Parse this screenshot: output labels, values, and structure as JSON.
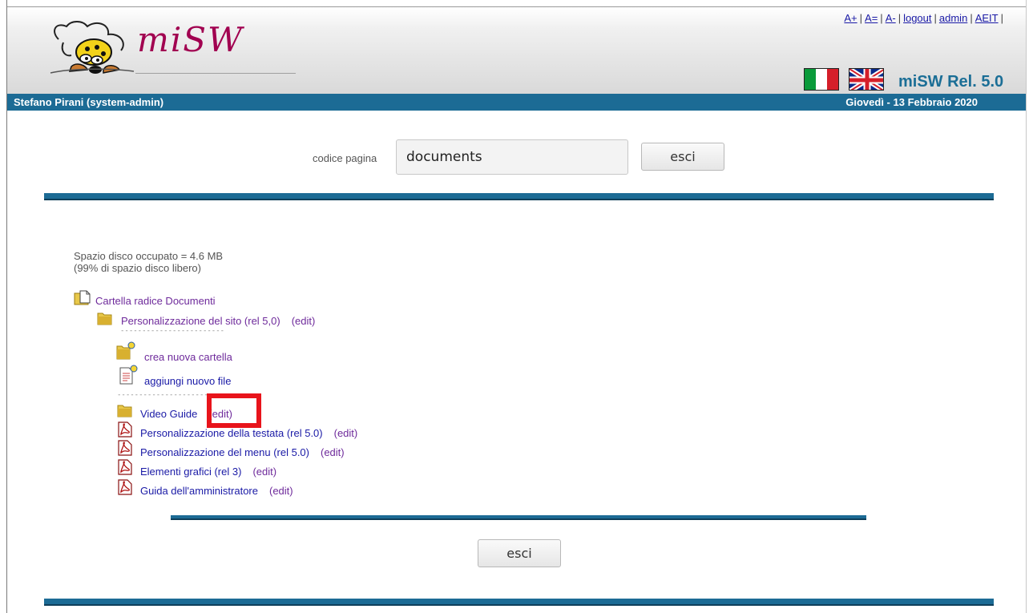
{
  "header": {
    "logo_text": "miSW",
    "toplinks": [
      "A+",
      "A=",
      "A-",
      "logout",
      "admin",
      "AEIT"
    ],
    "release": "miSW Rel. 5.0",
    "user": "Stefano Pirani (system-admin)",
    "date": "Giovedì - 13 Febbraio 2020"
  },
  "search": {
    "label": "codice pagina",
    "value": "documents",
    "exit_label": "esci"
  },
  "disk": {
    "used": "Spazio disco occupato = 4.6 MB",
    "free": "(99% di spazio disco libero)"
  },
  "tree": {
    "root": "Cartella radice Documenti",
    "folder": "Personalizzazione del sito (rel 5,0)",
    "folder_edit": "(edit)",
    "separator": "------------------------",
    "create_folder": "crea nuova cartella",
    "add_file": "aggiungi nuovo file",
    "items": [
      {
        "label": "Video Guide",
        "edit": "(edit)",
        "kind": "folder"
      },
      {
        "label": "Personalizzazione della testata (rel 5.0)",
        "edit": "(edit)",
        "kind": "pdf"
      },
      {
        "label": "Personalizzazione del menu (rel 5.0)",
        "edit": "(edit)",
        "kind": "pdf"
      },
      {
        "label": "Elementi grafici (rel 3)",
        "edit": "(edit)",
        "kind": "pdf"
      },
      {
        "label": "Guida dell'amministratore",
        "edit": "(edit)",
        "kind": "pdf"
      }
    ]
  },
  "footer": {
    "exit_label": "esci"
  },
  "colors": {
    "bar": "#1c6b95",
    "link_blue": "#1a1aa6",
    "link_purple": "#6e2a9b",
    "highlight": "#e8141b"
  }
}
